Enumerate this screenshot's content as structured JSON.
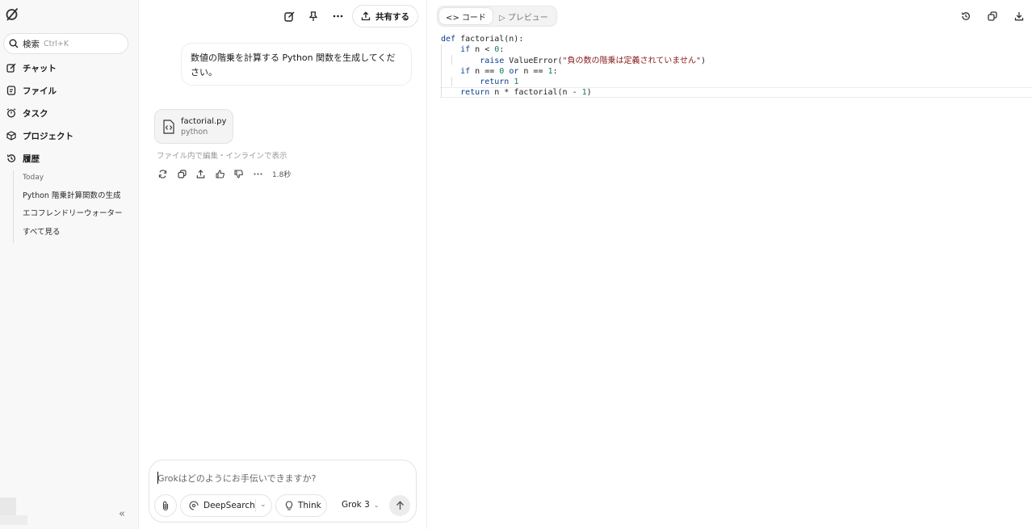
{
  "sidebar": {
    "logo_icon": "grok-logo-icon",
    "search": {
      "label": "検索",
      "shortcut": "Ctrl+K"
    },
    "nav": [
      {
        "label": "チャット",
        "icon": "chat-edit-icon"
      },
      {
        "label": "ファイル",
        "icon": "file-icon"
      },
      {
        "label": "タスク",
        "icon": "alarm-clock-icon"
      },
      {
        "label": "プロジェクト",
        "icon": "cube-icon"
      },
      {
        "label": "履歴",
        "icon": "history-icon"
      }
    ],
    "history": {
      "group": "Today",
      "items": [
        "Python 階乗計算関数の生成",
        "エコフレンドリーウォーター"
      ],
      "see_all": "すべて見る"
    },
    "collapse_label": "«"
  },
  "chat": {
    "toolbar": {
      "share_label": "共有する"
    },
    "user_message": "数値の階乗を計算する Python 関数を生成してください。",
    "attachment": {
      "filename": "factorial.py",
      "language": "python"
    },
    "attachment_hint": "ファイル内で編集・インラインで表示",
    "response_time": "1.8秒",
    "composer": {
      "placeholder": "Grokはどのようにお手伝いできますか?",
      "deepsearch_label": "DeepSearch",
      "think_label": "Think",
      "model_label": "Grok 3"
    }
  },
  "code_panel": {
    "tabs": {
      "code": "<> コード",
      "preview": "▷ プレビュー"
    },
    "code_lines": [
      [
        [
          "kw",
          "def"
        ],
        [
          "t",
          " factorial(n):"
        ]
      ],
      [
        [
          "t",
          "    "
        ],
        [
          "kw",
          "if"
        ],
        [
          "t",
          " n < "
        ],
        [
          "num",
          "0"
        ],
        [
          "t",
          ":"
        ]
      ],
      [
        [
          "t",
          "        "
        ],
        [
          "kw",
          "raise"
        ],
        [
          "t",
          " ValueError("
        ],
        [
          "str",
          "\"負の数の階乗は定義されていません\""
        ],
        [
          "t",
          ")"
        ]
      ],
      [
        [
          "t",
          "    "
        ],
        [
          "kw",
          "if"
        ],
        [
          "t",
          " n == "
        ],
        [
          "num",
          "0"
        ],
        [
          "t",
          " "
        ],
        [
          "kw",
          "or"
        ],
        [
          "t",
          " n == "
        ],
        [
          "num",
          "1"
        ],
        [
          "t",
          ":"
        ]
      ],
      [
        [
          "t",
          "        "
        ],
        [
          "kw",
          "return"
        ],
        [
          "t",
          " "
        ],
        [
          "num",
          "1"
        ]
      ],
      [
        [
          "t",
          "    "
        ],
        [
          "kw",
          "return"
        ],
        [
          "t",
          " n * factorial(n - "
        ],
        [
          "num",
          "1"
        ],
        [
          "t",
          ")"
        ]
      ]
    ]
  },
  "colors": {
    "keyword": "#0b3d91",
    "number": "#0a7d5a",
    "string": "#8a1a1a",
    "sidebar_bg": "#f8f8f8"
  }
}
